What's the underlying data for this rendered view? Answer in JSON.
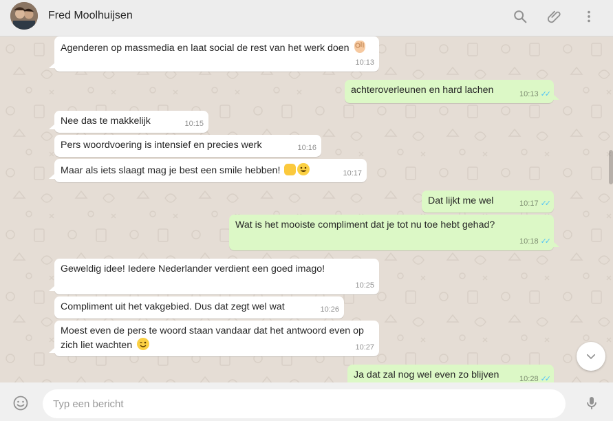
{
  "header": {
    "contact_name": "Fred Moolhuijsen",
    "icons": [
      "search-icon",
      "attach-icon",
      "menu-icon"
    ]
  },
  "messages": [
    {
      "dir": "in",
      "text": "Agenderen op massmedia en laat social de rest van het werk doen",
      "time": "10:13",
      "emoji": "ok-hand"
    },
    {
      "dir": "out",
      "text": "achteroverleunen en hard lachen",
      "time": "10:13",
      "read": true
    },
    {
      "dir": "in",
      "text": "Nee das te makkelijk",
      "time": "10:15"
    },
    {
      "dir": "in",
      "text": "Pers woordvoering is intensief en precies werk",
      "time": "10:16"
    },
    {
      "dir": "in",
      "text": "Maar als iets slaagt mag je best een smile hebben!",
      "time": "10:17",
      "emoji": "thumbs-up-smiley"
    },
    {
      "dir": "out",
      "text": "Dat lijkt me wel",
      "time": "10:17",
      "read": true
    },
    {
      "dir": "out",
      "text": "Wat is het mooiste compliment dat je tot nu toe hebt gehad?",
      "time": "10:18",
      "read": true
    },
    {
      "dir": "in",
      "text": "Geweldig idee! Iedere Nederlander verdient een goed imago!",
      "time": "10:25"
    },
    {
      "dir": "in",
      "text": "Compliment uit het vakgebied. Dus dat zegt wel wat",
      "time": "10:26"
    },
    {
      "dir": "in",
      "text": "Moest even de pers te woord staan vandaar dat het antwoord even op\nzich liet wachten",
      "time": "10:27",
      "emoji": "wink"
    },
    {
      "dir": "out",
      "text": "Ja dat zal nog wel even zo blijven",
      "time": "10:28",
      "read": true
    }
  ],
  "composer": {
    "placeholder": "Typ een bericht"
  },
  "colors": {
    "chat_bg": "#e5ddd5",
    "incoming": "#ffffff",
    "outgoing": "#dcf8c6",
    "read_ticks": "#4fc3f7",
    "header_bg": "#ededed"
  }
}
